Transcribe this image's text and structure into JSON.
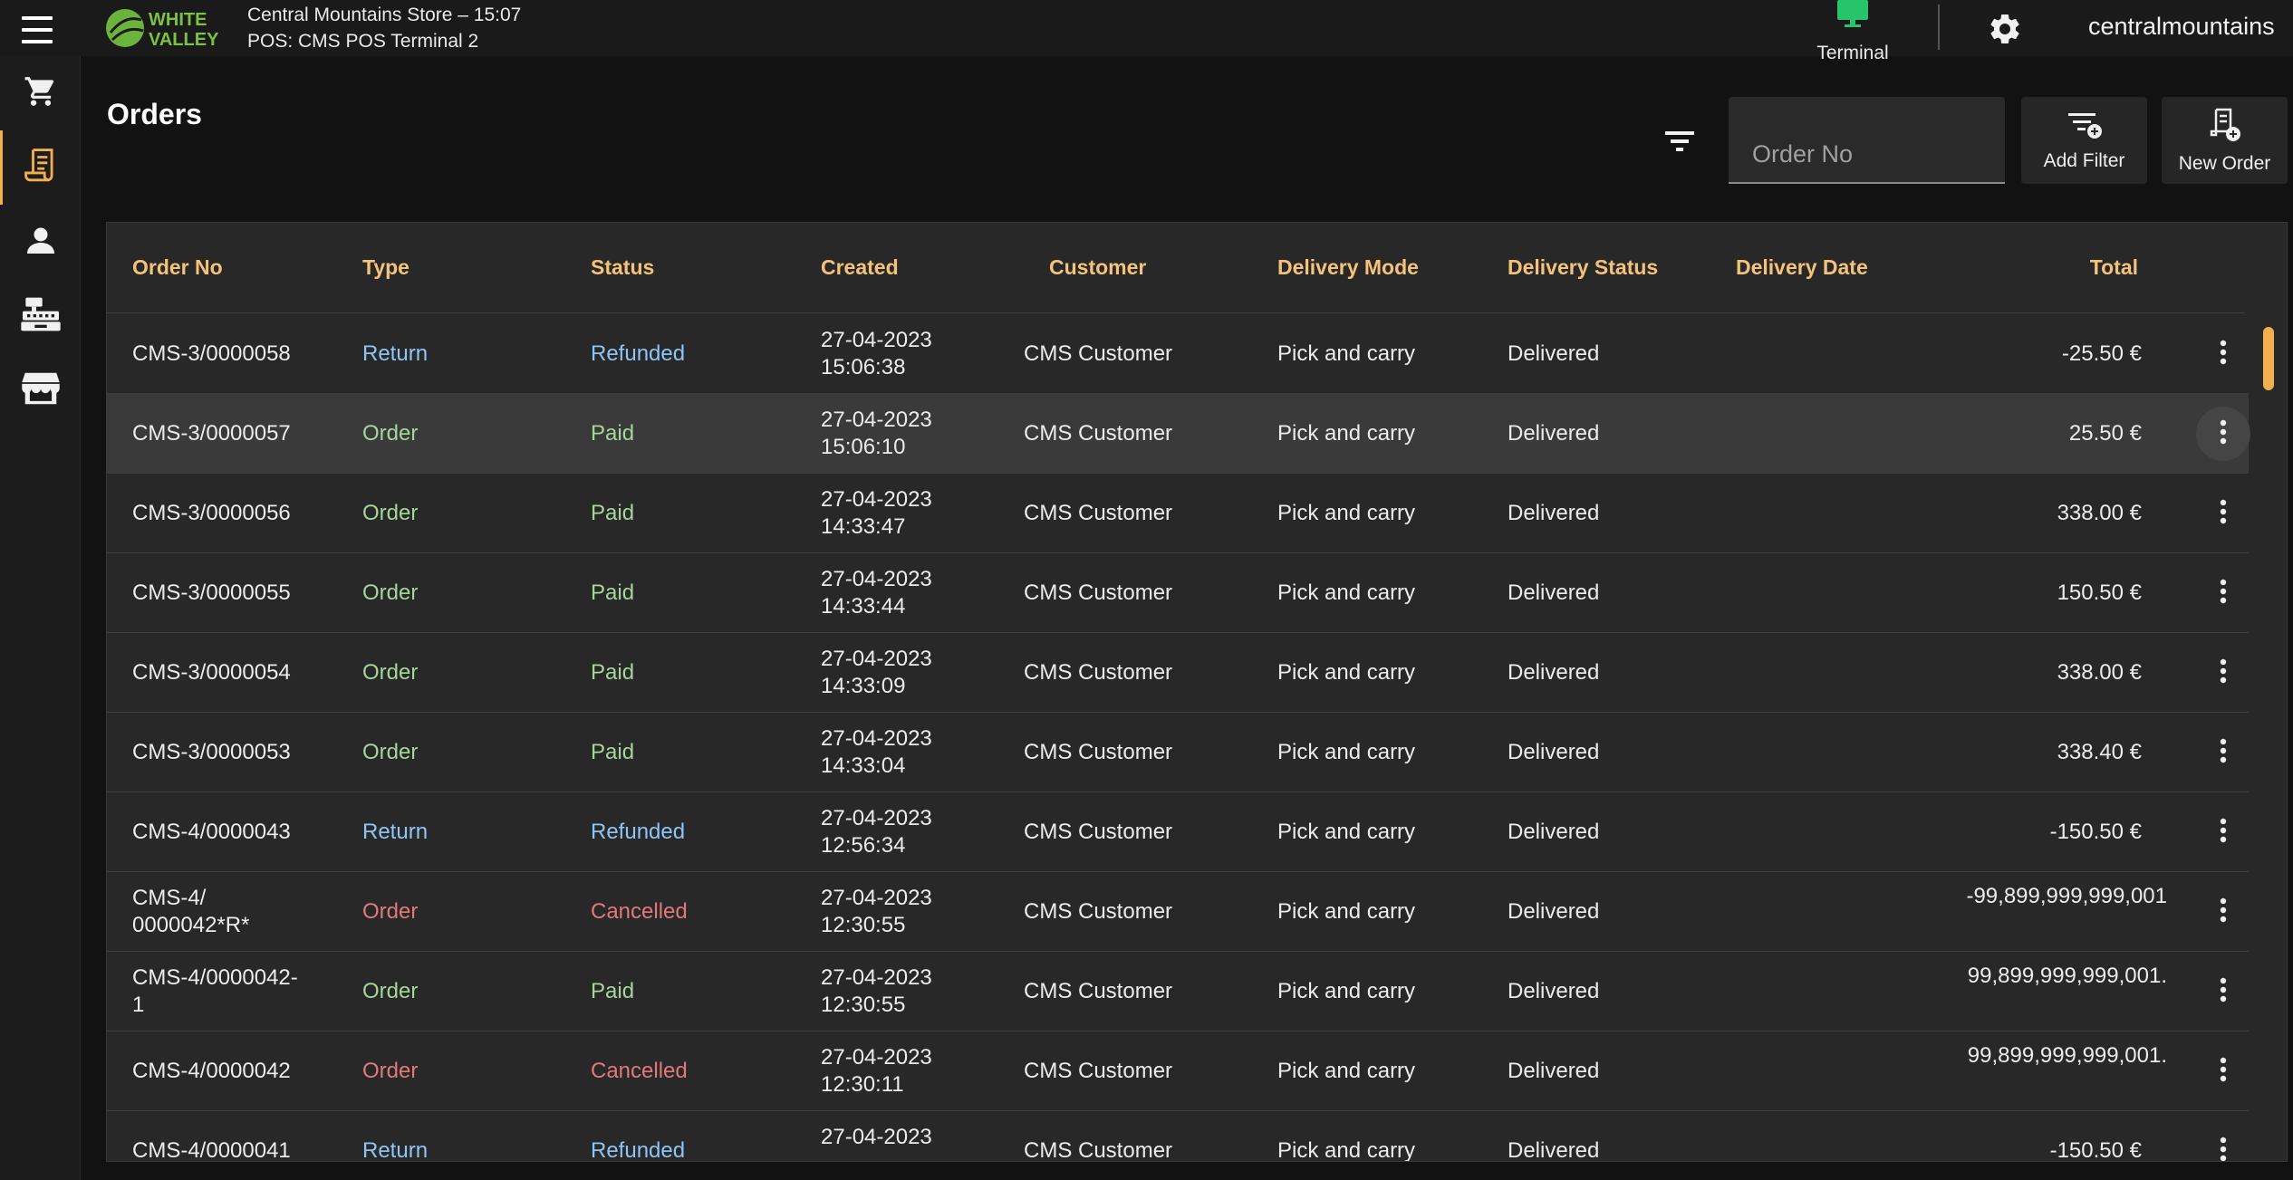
{
  "app": {
    "store_line": "Central Mountains Store – 15:07",
    "pos_line": "POS: CMS POS Terminal 2",
    "logo_text": [
      "WHITE",
      "VALLEY"
    ],
    "terminal_label": "Terminal",
    "username": "centralmountains"
  },
  "icons": {
    "menu": "hamburger-icon",
    "terminal": "monitor-icon",
    "settings": "gear-icon",
    "nav": [
      "cart-icon",
      "receipt-icon",
      "person-icon",
      "cash-register-icon",
      "store-icon"
    ],
    "filter": "filter-lines-icon",
    "add_filter": "filter-plus-icon",
    "new_order": "receipt-plus-icon",
    "row_menu": "kebab-vertical-icon"
  },
  "page": {
    "title": "Orders",
    "search_placeholder": "Order No",
    "add_filter_label": "Add Filter",
    "new_order_label": "New Order"
  },
  "colors": {
    "accent": "#f0b04f",
    "header_text": "#f5c27a",
    "return": "#8ec5f5",
    "paid_order": "#a5d69a",
    "cancelled": "#e07a7a",
    "terminal_green": "#27c46b"
  },
  "table": {
    "headers": [
      "Order No",
      "Type",
      "Status",
      "Created",
      "Customer",
      "Delivery Mode",
      "Delivery Status",
      "Delivery Date",
      "Total"
    ],
    "rows": [
      {
        "no": "CMS-3/0000058",
        "type": "Return",
        "status": "Refunded",
        "date": "27-04-2023",
        "time": "15:06:38",
        "customer": "CMS Customer",
        "mode": "Pick and carry",
        "dstatus": "Delivered",
        "total": "-25.50 €"
      },
      {
        "no": "CMS-3/0000057",
        "type": "Order",
        "status": "Paid",
        "date": "27-04-2023",
        "time": "15:06:10",
        "customer": "CMS Customer",
        "mode": "Pick and carry",
        "dstatus": "Delivered",
        "total": "25.50 €"
      },
      {
        "no": "CMS-3/0000056",
        "type": "Order",
        "status": "Paid",
        "date": "27-04-2023",
        "time": "14:33:47",
        "customer": "CMS Customer",
        "mode": "Pick and carry",
        "dstatus": "Delivered",
        "total": "338.00 €"
      },
      {
        "no": "CMS-3/0000055",
        "type": "Order",
        "status": "Paid",
        "date": "27-04-2023",
        "time": "14:33:44",
        "customer": "CMS Customer",
        "mode": "Pick and carry",
        "dstatus": "Delivered",
        "total": "150.50 €"
      },
      {
        "no": "CMS-3/0000054",
        "type": "Order",
        "status": "Paid",
        "date": "27-04-2023",
        "time": "14:33:09",
        "customer": "CMS Customer",
        "mode": "Pick and carry",
        "dstatus": "Delivered",
        "total": "338.00 €"
      },
      {
        "no": "CMS-3/0000053",
        "type": "Order",
        "status": "Paid",
        "date": "27-04-2023",
        "time": "14:33:04",
        "customer": "CMS Customer",
        "mode": "Pick and carry",
        "dstatus": "Delivered",
        "total": "338.40 €"
      },
      {
        "no": "CMS-4/0000043",
        "type": "Return",
        "status": "Refunded",
        "date": "27-04-2023",
        "time": "12:56:34",
        "customer": "CMS Customer",
        "mode": "Pick and carry",
        "dstatus": "Delivered",
        "total": "-150.50 €"
      },
      {
        "no_1": "CMS-4/",
        "no_2": "0000042*R*",
        "type": "Order",
        "status": "Cancelled",
        "date": "27-04-2023",
        "time": "12:30:55",
        "customer": "CMS Customer",
        "mode": "Pick and carry",
        "dstatus": "Delivered",
        "total": "-99,899,999,999,001"
      },
      {
        "no_1": "CMS-4/0000042-",
        "no_2": "1",
        "type": "Order",
        "status": "Paid",
        "date": "27-04-2023",
        "time": "12:30:55",
        "customer": "CMS Customer",
        "mode": "Pick and carry",
        "dstatus": "Delivered",
        "total": "99,899,999,999,001."
      },
      {
        "no": "CMS-4/0000042",
        "type": "Order",
        "status": "Cancelled",
        "date": "27-04-2023",
        "time": "12:30:11",
        "customer": "CMS Customer",
        "mode": "Pick and carry",
        "dstatus": "Delivered",
        "total": "99,899,999,999,001."
      },
      {
        "no": "CMS-4/0000041",
        "type": "Return",
        "status": "Refunded",
        "date": "27-04-2023",
        "time": "",
        "customer": "CMS Customer",
        "mode": "Pick and carry",
        "dstatus": "Delivered",
        "total": "-150.50 €"
      }
    ]
  }
}
